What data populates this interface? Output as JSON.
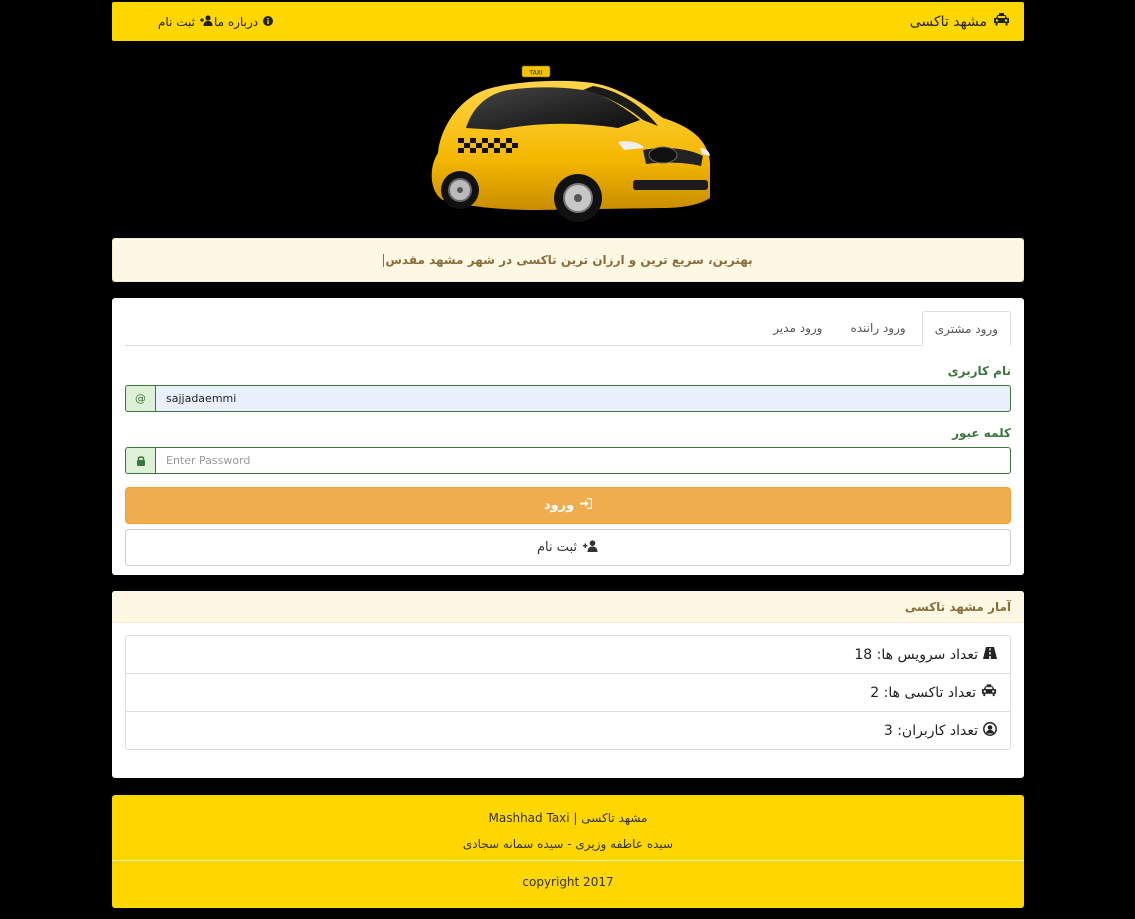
{
  "navbar": {
    "brand": "مشهد تاکسی",
    "brand_icon": "taxi-icon",
    "links": [
      {
        "label": "درباره ما",
        "icon": "info-icon"
      },
      {
        "label": "ثبت نام",
        "icon": "user-plus-icon"
      }
    ]
  },
  "hero": {
    "image": "yellow-taxi-car"
  },
  "slogan": {
    "text": "بهترین، سریع ترین و ارزان ترین تاکسی در شهر مشهد مقدس"
  },
  "login": {
    "tabs": [
      {
        "label": "ورود مشتری",
        "active": true
      },
      {
        "label": "ورود راننده",
        "active": false
      },
      {
        "label": "ورود مدیر",
        "active": false
      }
    ],
    "username_label": "نام کاربری",
    "username_addon": "@",
    "username_value": "sajjadaemmi",
    "password_label": "کلمه عبور",
    "password_placeholder": "Enter Password",
    "login_button": "ورود",
    "register_button": "ثبت نام"
  },
  "stats": {
    "heading": "آمار مشهد تاکسی",
    "items": [
      {
        "label": "تعداد سرویس ها: 18",
        "icon": "road-icon"
      },
      {
        "label": "تعداد تاکسی ها: 2",
        "icon": "taxi-icon"
      },
      {
        "label": "تعداد کاربران: 3",
        "icon": "user-circle-icon"
      }
    ]
  },
  "footer": {
    "line1": "مشهد تاکسی | Mashhad Taxi",
    "line2": "سیده عاطفه وزیری - سیده سمانه سجادی",
    "copyright": "copyright 2017"
  },
  "colors": {
    "brand_yellow": "#ffd700",
    "login_orange": "#f0ad4e",
    "success_green": "#3c763d",
    "warning_bg": "#fcf8e3"
  }
}
